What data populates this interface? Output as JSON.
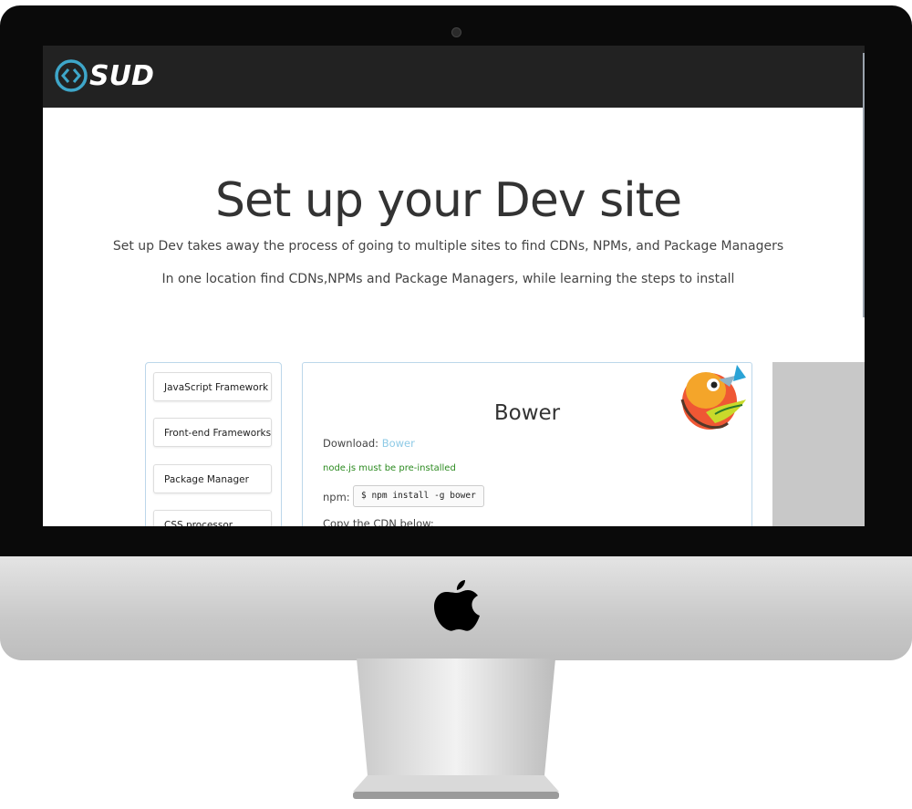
{
  "device": {
    "logo_icon": "apple-icon"
  },
  "navbar": {
    "brand_text": "SUD",
    "brand_icon": "code-brackets-icon",
    "background": "#222222"
  },
  "hero": {
    "title": "Set up your Dev site",
    "subtitle_1": "Set up Dev takes away the process of going to multiple sites to find CDNs, NPMs, and Package Managers",
    "subtitle_2": "In one location find CDNs,NPMs and Package Managers, while learning the steps to install"
  },
  "sidebar": {
    "items": [
      {
        "label": "JavaScript Framework"
      },
      {
        "label": "Front-end Frameworks"
      },
      {
        "label": "Package Manager"
      },
      {
        "label": "CSS processor"
      }
    ]
  },
  "panel": {
    "title": "Bower",
    "download_label": "Download:",
    "download_link": "Bower",
    "note": "node.js must be pre-installed",
    "npm_label": "npm:",
    "npm_command": "$ npm install -g bower",
    "cdn_label": "Copy the CDN below:",
    "logo_icon": "bower-bird-logo"
  },
  "colors": {
    "accent_link": "#8ecae6",
    "note_green": "#2b8a1f",
    "border_blue": "#bcd7ea"
  }
}
